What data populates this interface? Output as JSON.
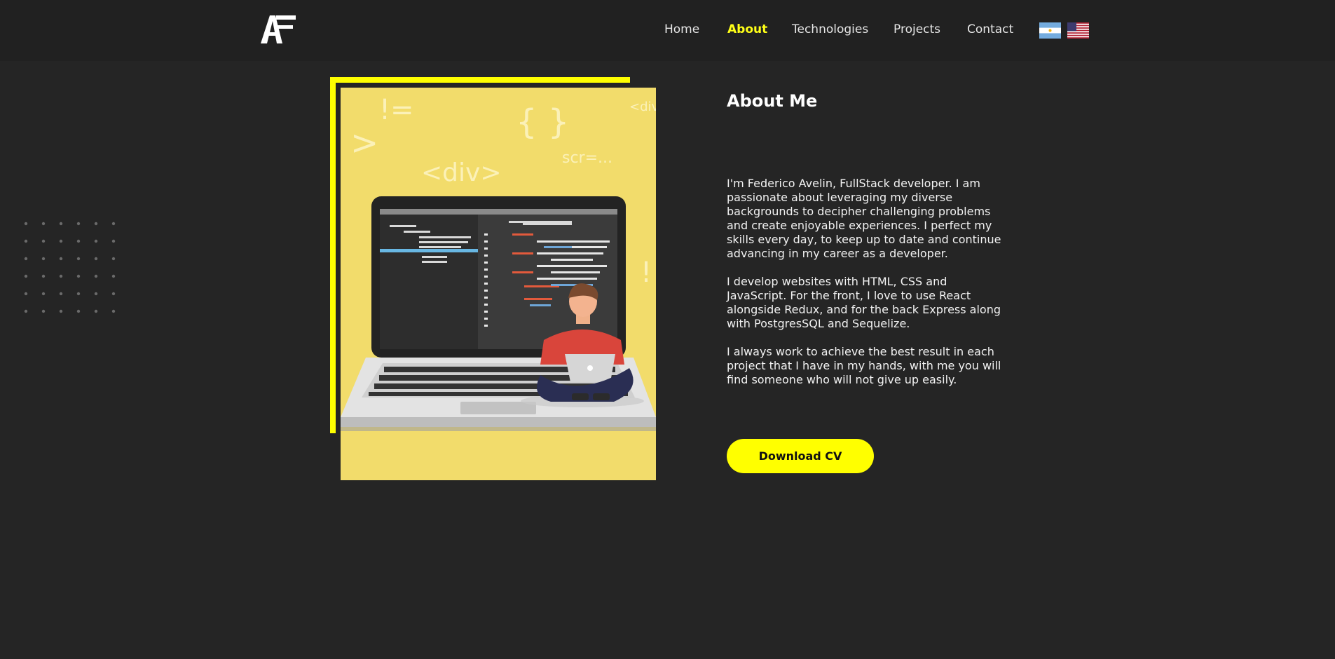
{
  "header": {
    "logo_text": "AF",
    "nav": [
      {
        "label": "Home"
      },
      {
        "label": "About"
      },
      {
        "label": "Technologies"
      },
      {
        "label": "Projects"
      },
      {
        "label": "Contact"
      }
    ],
    "active_nav": "About",
    "languages": [
      "argentina-flag",
      "usa-flag"
    ]
  },
  "illustration": {
    "code_glyphs": [
      "!=",
      "{ }",
      "<div",
      ">",
      "scr=...",
      "<div>",
      "!"
    ]
  },
  "about": {
    "title": "About Me",
    "paragraphs": [
      "I'm Federico Avelin, FullStack developer. I am passionate about leveraging my diverse backgrounds to decipher challenging problems and create enjoyable experiences. I perfect my skills every day, to keep up to date and continue advancing in my career as a developer.",
      "I develop websites with HTML, CSS and JavaScript. For the front, I love to use React alongside Redux, and for the back Express along with PostgresSQL and Sequelize.",
      "I always work to achieve the best result in each project that I have in my hands, with me you will find someone who will not give up easily."
    ],
    "cv_button": "Download CV"
  },
  "colors": {
    "accent": "#ffff00",
    "background": "#252525",
    "header": "#212121",
    "illustration_bg": "#f2dc6b"
  }
}
